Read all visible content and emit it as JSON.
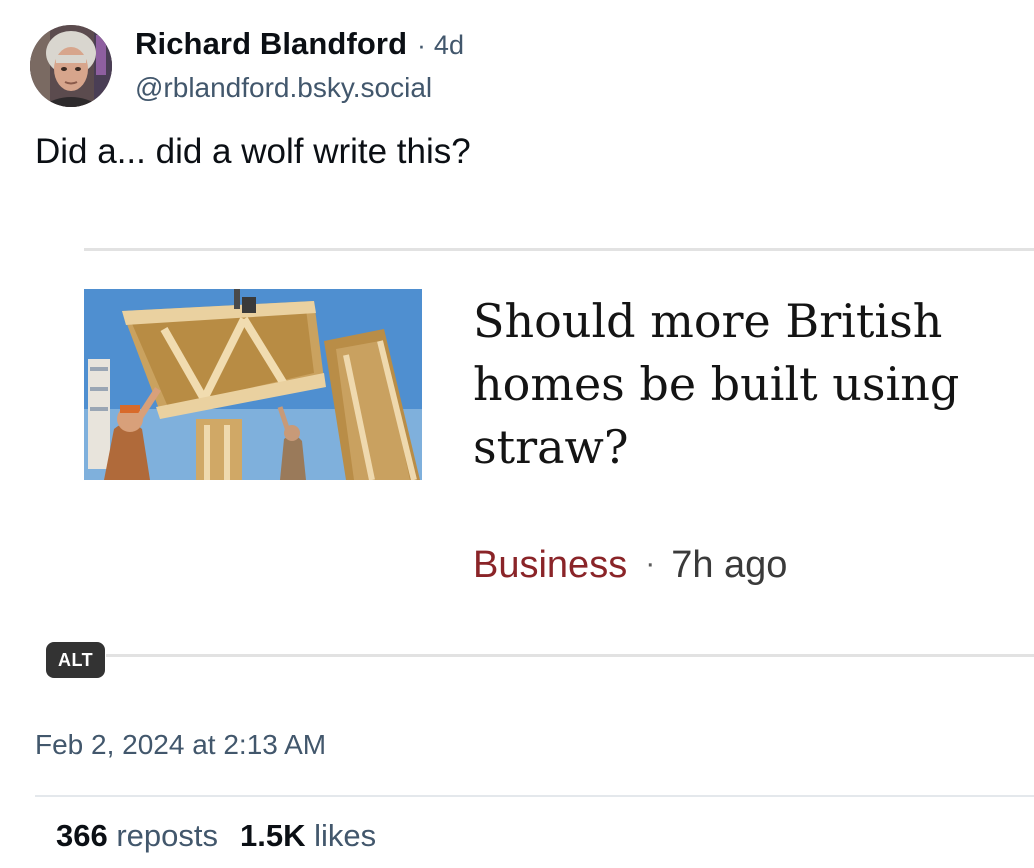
{
  "post": {
    "author_name": "Richard Blandford",
    "separator": "·",
    "age": "4d",
    "handle": "@rblandford.bsky.social",
    "text": "Did a... did a wolf write this?",
    "timestamp": "Feb 2, 2024 at 2:13 AM"
  },
  "embed": {
    "headline": "Should more British homes be built using straw?",
    "category": "Business",
    "separator": "·",
    "age": "7h ago",
    "alt_label": "ALT"
  },
  "stats": {
    "reposts_count": "366",
    "reposts_label": "reposts",
    "likes_count": "1.5K",
    "likes_label": "likes"
  },
  "colors": {
    "category": "#8a2428",
    "secondary_text": "#42576c",
    "alt_badge": "#333333"
  },
  "icons": {
    "avatar": "user-avatar-photo",
    "thumbnail": "straw-panel-construction-photo"
  }
}
